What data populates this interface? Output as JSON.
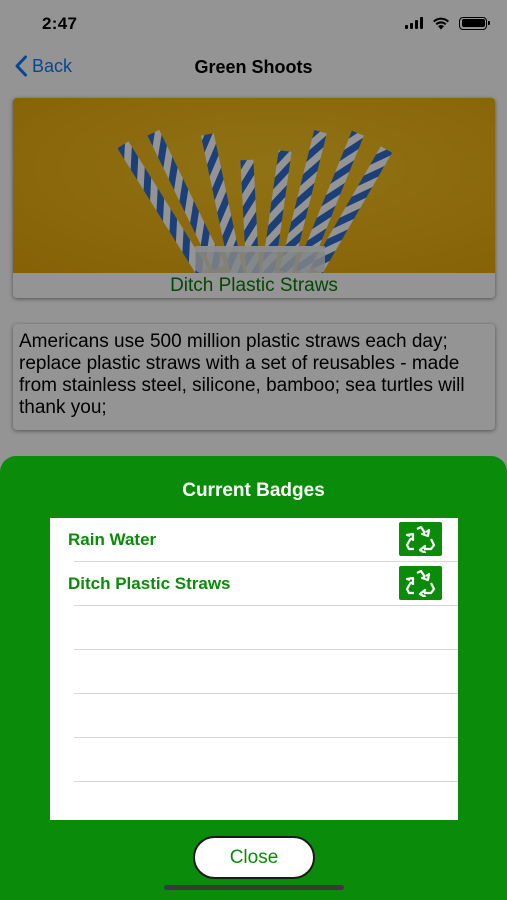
{
  "status_bar": {
    "time": "2:47"
  },
  "nav": {
    "back_label": "Back",
    "title": "Green Shoots"
  },
  "hero": {
    "caption": "Ditch Plastic Straws"
  },
  "description": "Americans use 500 million plastic straws each day; replace plastic straws with a set of reusables - made from stainless steel, silicone, bamboo; sea turtles will thank you;",
  "sheet": {
    "title": "Current Badges",
    "badges": [
      {
        "label": "Rain Water",
        "icon": "recycle-icon"
      },
      {
        "label": "Ditch Plastic Straws",
        "icon": "recycle-icon"
      }
    ],
    "close_label": "Close"
  },
  "colors": {
    "accent_green": "#0a8c0a",
    "caption_green": "#0a7a0a",
    "link_blue": "#0a7aff",
    "image_background": "#f2b40f"
  }
}
